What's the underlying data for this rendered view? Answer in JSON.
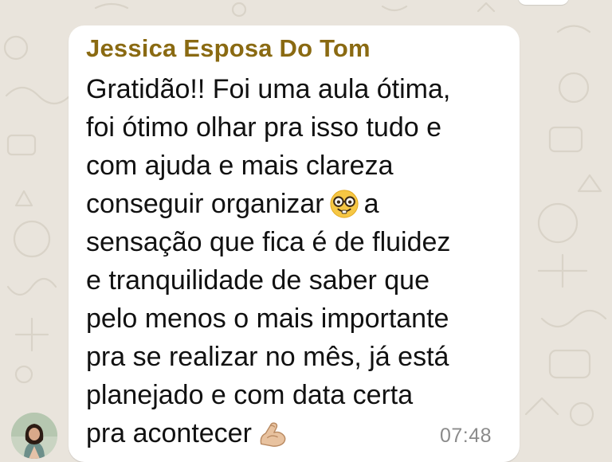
{
  "chat": {
    "message": {
      "sender_name": "Jessica Esposa Do Tom",
      "lines": [
        {
          "text": "Gratidão!! Foi uma aula ótima,"
        },
        {
          "text": "foi ótimo olhar pra isso tudo e"
        },
        {
          "text": "com ajuda e mais clareza"
        },
        {
          "before": "conseguir organizar",
          "emoji": "nerd-face-emoji",
          "after": "a"
        },
        {
          "text": "sensação que fica é de fluidez"
        },
        {
          "text": "e tranquilidade de saber que"
        },
        {
          "text": "pelo menos o mais importante"
        },
        {
          "text": "pra se realizar no mês, já está"
        },
        {
          "text": "planejado e com data certa"
        },
        {
          "before": "pra acontecer",
          "emoji": "flexed-biceps-emoji",
          "after": ""
        }
      ],
      "time": "07:48"
    }
  },
  "colors": {
    "sender_name": "#8a6a12",
    "bubble": "#ffffff",
    "wallpaper": "#e9e4dc",
    "timestamp": "#8b8b8b"
  }
}
